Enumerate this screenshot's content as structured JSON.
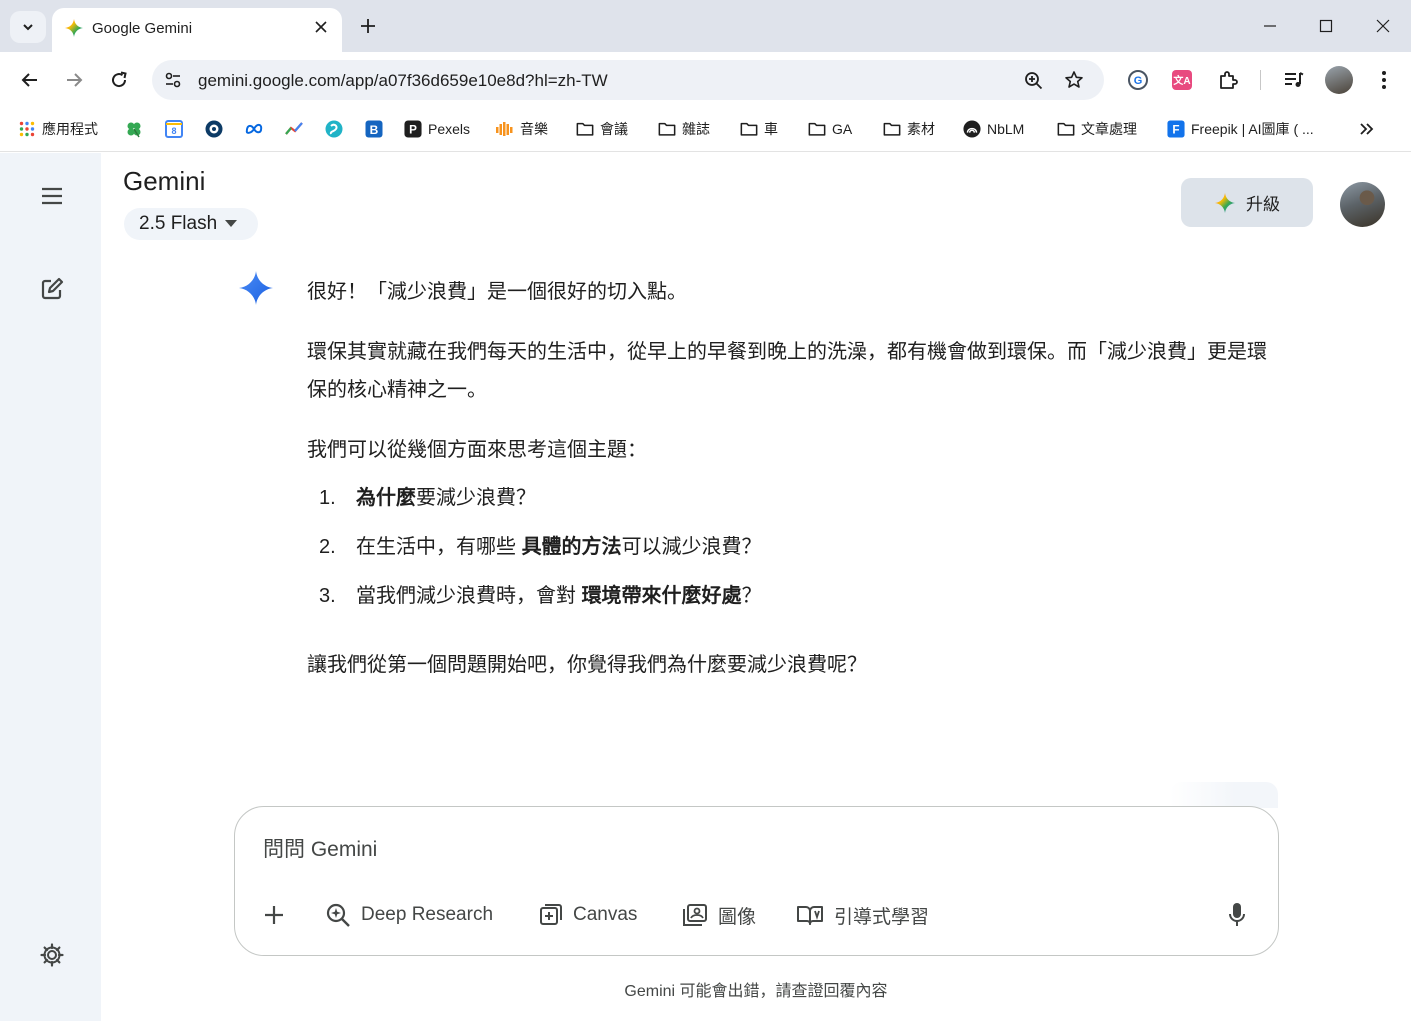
{
  "browser": {
    "tab_title": "Google Gemini",
    "url": "gemini.google.com/app/a07f36d659e10e8d?hl=zh-TW",
    "bookmarks": [
      {
        "label": "應用程式",
        "icon": "apps-grid-icon"
      },
      {
        "label": "",
        "icon": "clover-icon"
      },
      {
        "label": "",
        "icon": "calendar-8-icon"
      },
      {
        "label": "",
        "icon": "eye-circle-icon"
      },
      {
        "label": "",
        "icon": "meta-icon"
      },
      {
        "label": "",
        "icon": "trend-icon"
      },
      {
        "label": "",
        "icon": "swirl-icon"
      },
      {
        "label": "",
        "icon": "b-square-icon"
      },
      {
        "label": "Pexels",
        "icon": "pexels-icon"
      },
      {
        "label": "音樂",
        "icon": "music-bars-icon"
      },
      {
        "label": "會議",
        "icon": "folder-icon"
      },
      {
        "label": "雜誌",
        "icon": "folder-icon"
      },
      {
        "label": "車",
        "icon": "folder-icon"
      },
      {
        "label": "GA",
        "icon": "folder-icon"
      },
      {
        "label": "素材",
        "icon": "folder-icon"
      },
      {
        "label": "NbLM",
        "icon": "notebooklm-icon"
      },
      {
        "label": "文章處理",
        "icon": "folder-icon"
      },
      {
        "label": "Freepik | AI圖庫 ( ...",
        "icon": "freepik-icon"
      }
    ]
  },
  "app": {
    "title": "Gemini",
    "model": "2.5 Flash",
    "upgrade_label": "升級"
  },
  "message": {
    "intro": "很好！「減少浪費」是一個很好的切入點。",
    "para1": "環保其實就藏在我們每天的生活中，從早上的早餐到晚上的洗澡，都有機會做到環保。而「減少浪費」更是環保的核心精神之一。",
    "para2": "我們可以從幾個方面來思考這個主題：",
    "items": [
      {
        "num": "1.",
        "pre": "",
        "bold": "為什麼",
        "post": "要減少浪費？"
      },
      {
        "num": "2.",
        "pre": "在生活中，有哪些 ",
        "bold": "具體的方法",
        "post": "可以減少浪費？"
      },
      {
        "num": "3.",
        "pre": "當我們減少浪費時，會對 ",
        "bold": "環境帶來什麼好處",
        "post": "？"
      }
    ],
    "closing": "讓我們從第一個問題開始吧，你覺得我們為什麼要減少浪費呢？"
  },
  "composer": {
    "placeholder": "問問 Gemini",
    "tools": {
      "deep_research": "Deep Research",
      "canvas": "Canvas",
      "image": "圖像",
      "guided_learning": "引導式學習"
    }
  },
  "disclaimer": "Gemini 可能會出錯，請查證回覆內容"
}
